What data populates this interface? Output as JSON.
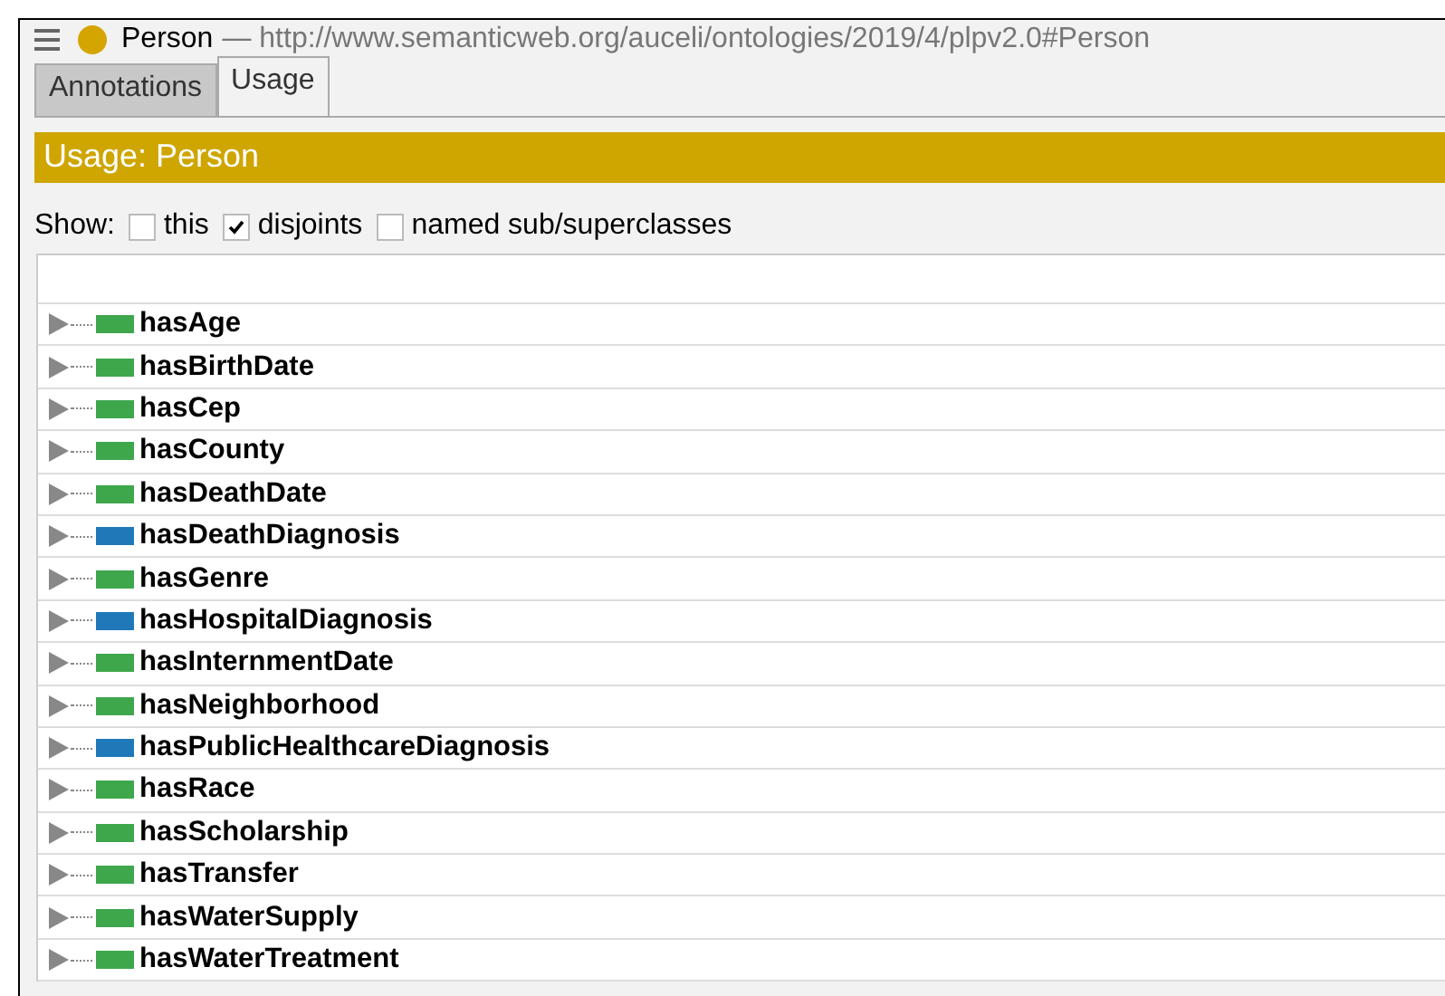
{
  "header": {
    "title": "Person",
    "iri": "— http://www.semanticweb.org/auceli/ontologies/2019/4/plpv2.0#Person"
  },
  "tabs": [
    {
      "label": "Annotations",
      "selected": false
    },
    {
      "label": "Usage",
      "selected": true
    }
  ],
  "banner": "Usage: Person",
  "show": {
    "label": "Show:",
    "options": [
      {
        "label": "this",
        "checked": false
      },
      {
        "label": "disjoints",
        "checked": true
      },
      {
        "label": "named sub/superclasses",
        "checked": false
      }
    ]
  },
  "properties": [
    {
      "name": "hasAge",
      "color": "#3ea64b"
    },
    {
      "name": "hasBirthDate",
      "color": "#3ea64b"
    },
    {
      "name": "hasCep",
      "color": "#3ea64b"
    },
    {
      "name": "hasCounty",
      "color": "#3ea64b"
    },
    {
      "name": "hasDeathDate",
      "color": "#3ea64b"
    },
    {
      "name": "hasDeathDiagnosis",
      "color": "#1f78b8"
    },
    {
      "name": "hasGenre",
      "color": "#3ea64b"
    },
    {
      "name": "hasHospitalDiagnosis",
      "color": "#1f78b8"
    },
    {
      "name": "hasInternmentDate",
      "color": "#3ea64b"
    },
    {
      "name": "hasNeighborhood",
      "color": "#3ea64b"
    },
    {
      "name": "hasPublicHealthcareDiagnosis",
      "color": "#1f78b8"
    },
    {
      "name": "hasRace",
      "color": "#3ea64b"
    },
    {
      "name": "hasScholarship",
      "color": "#3ea64b"
    },
    {
      "name": "hasTransfer",
      "color": "#3ea64b"
    },
    {
      "name": "hasWaterSupply",
      "color": "#3ea64b"
    },
    {
      "name": "hasWaterTreatment",
      "color": "#3ea64b"
    }
  ]
}
